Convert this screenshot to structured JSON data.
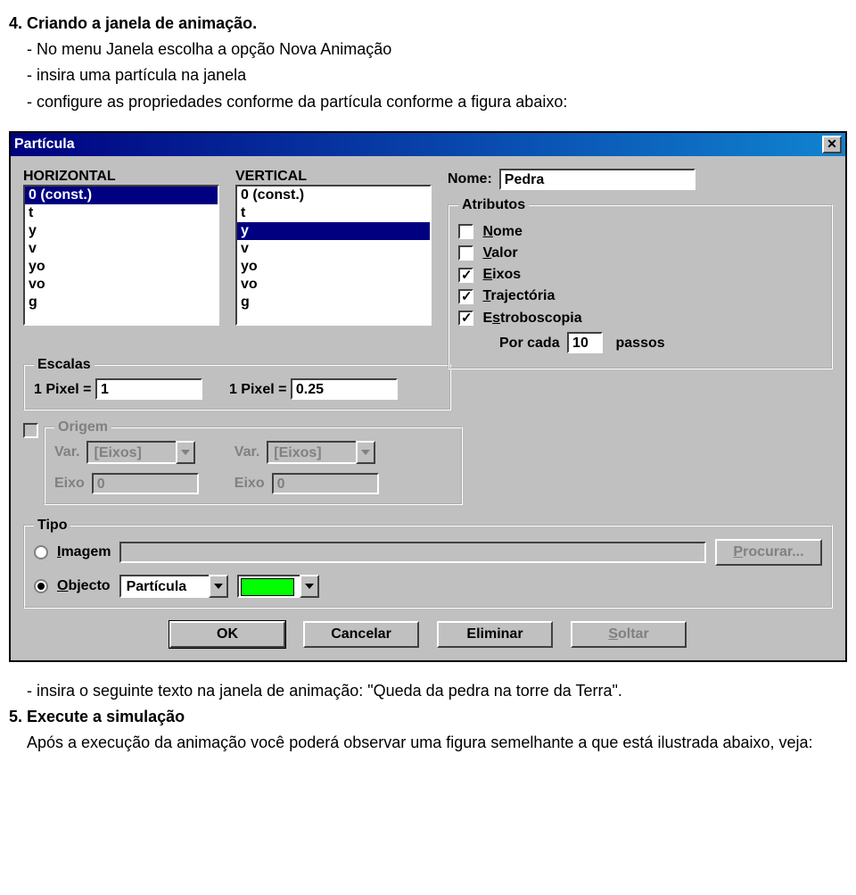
{
  "doc": {
    "step4_title": "4. Criando a janela de animação.",
    "step4_line1": "- No menu Janela escolha a opção Nova Animação",
    "step4_line2": "- insira uma partícula na janela",
    "step4_line3": "- configure as propriedades conforme da partícula conforme a figura abaixo:",
    "post_line": "- insira o seguinte texto na janela de animação: \"Queda da pedra na torre da Terra\".",
    "step5_title": "5. Execute a simulação",
    "step5_para": "Após a execução da animação você poderá observar uma figura semelhante a que está ilustrada abaixo, veja:"
  },
  "dialog": {
    "title": "Partícula",
    "horizontal_label": "HORIZONTAL",
    "vertical_label": "VERTICAL",
    "list_items": [
      "0 (const.)",
      "t",
      "y",
      "v",
      "yo",
      "vo",
      "g"
    ],
    "horizontal_selected": "0 (const.)",
    "vertical_selected": "y",
    "escalas": {
      "legend": "Escalas",
      "prefix": "1 Pixel =",
      "h_value": "1",
      "v_value": "0.25"
    },
    "origem": {
      "legend": "Origem",
      "var_label": "Var.",
      "var_value": "[Eixos]",
      "eixo_label": "Eixo",
      "eixo_value": "0"
    },
    "nome_label": "Nome:",
    "nome_value": "Pedra",
    "atributos": {
      "legend": "Atributos",
      "nome": "Nome",
      "valor": "Valor",
      "eixos": "Eixos",
      "trajectoria": "Trajectória",
      "estroboscopia": "Estroboscopia",
      "por_cada": "Por cada",
      "passos_value": "10",
      "passos_label": "passos"
    },
    "tipo": {
      "legend": "Tipo",
      "imagem": "Imagem",
      "objecto": "Objecto",
      "objecto_value": "Partícula",
      "procurar": "Procurar..."
    },
    "buttons": {
      "ok": "OK",
      "cancelar": "Cancelar",
      "eliminar": "Eliminar",
      "soltar": "Soltar"
    }
  }
}
